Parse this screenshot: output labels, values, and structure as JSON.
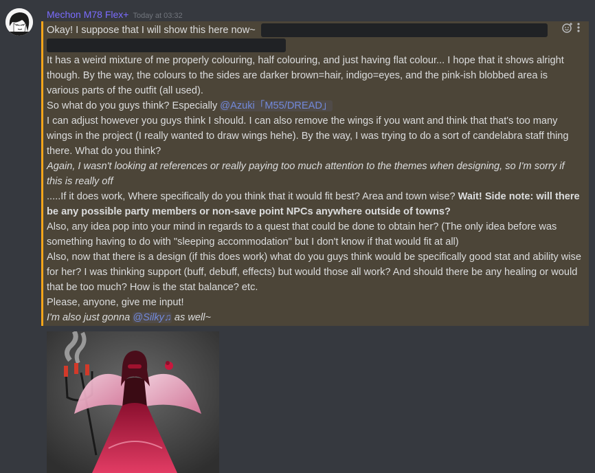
{
  "author": {
    "username": "Mechon M78 Flex+",
    "timestamp": "Today at 03:32"
  },
  "message": {
    "line1": "Okay! I suppose that I will show this here now~",
    "line2": "It has a weird mixture of me properly colouring, half colouring, and just having flat colour... I hope that it shows alright though. By the way, the colours to the sides are darker brown=hair, indigo=eyes, and the pink-ish blobbed area is various parts of the outfit (all used).",
    "line3_prefix": "So what do you guys think? Especially ",
    "mention_azuki": "@Azuki「M55/DREAD」",
    "line4": "I can adjust however you guys think I should. I can also remove the wings if you want and think that that's too many wings in the project (I really wanted to draw wings hehe). By the way, I was trying to do a sort of candelabra staff thing there. What do you think?",
    "line5_italic": "Again, I wasn't looking at references or really paying too much attention to the themes when designing, so I'm sorry if this is really off",
    "line6_prefix": ".....If it does work, Where specifically do you think that it would fit best? Area and town wise? ",
    "line6_bold": "Wait! Side note: will there be any possible party members or non-save point NPCs anywhere outside of towns?",
    "line7": "Also, any idea pop into your mind in regards to a quest that could be done to obtain her? (The only idea before was something having to do with \"sleeping accommodation\" but I don't know if that would fit at all)",
    "line8": "Also, now that there is a design (if this does work) what do you guys think would be specifically good stat and ability wise for her? I was thinking support (buff, debuff, effects) but would those all work? And should there be any healing or would that be too much? How is the stat balance? etc.",
    "line9": "Please, anyone, give me input!",
    "line10_prefix": "I'm also just gonna ",
    "mention_silky": "@Silky♫",
    "line10_suffix": " as well~"
  },
  "colors": {
    "username": "#7b6cff",
    "highlight_bg": "#4c4538",
    "highlight_bar": "#faa61a",
    "mention": "#7289da"
  },
  "icons": [
    "add-reaction-icon",
    "more-options-icon"
  ]
}
